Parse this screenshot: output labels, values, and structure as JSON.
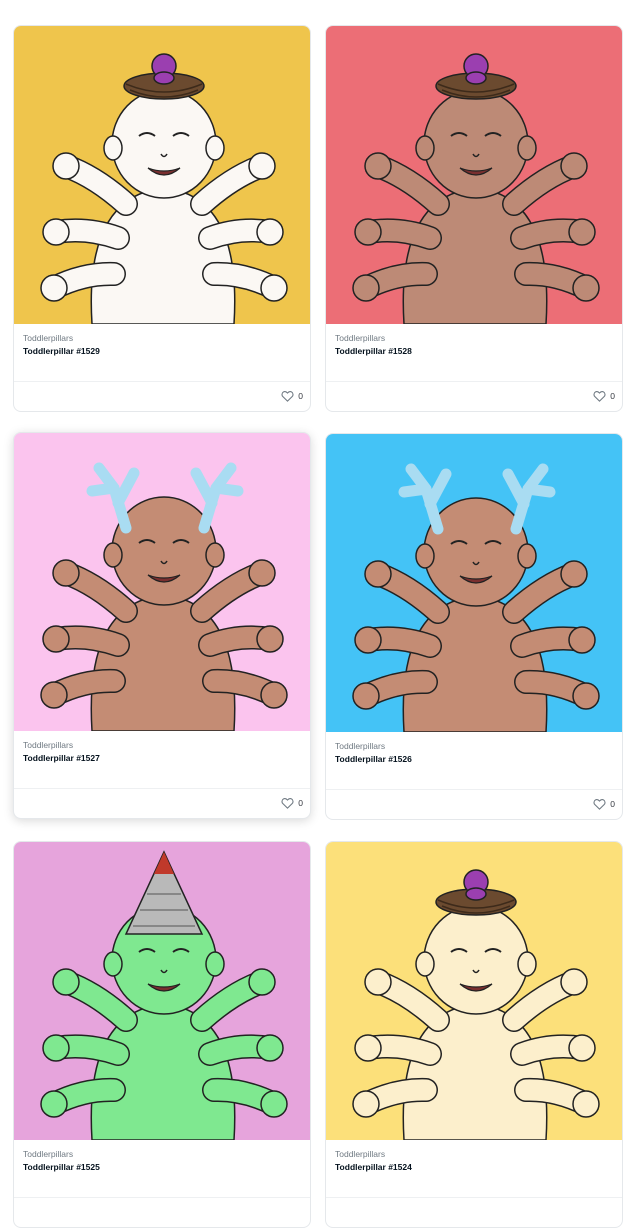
{
  "cards": [
    {
      "collection": "Toddlerpillars",
      "title": "Toddlerpillar #1529",
      "likes": "0",
      "bg": "#efc54c",
      "skin": "#fbf8f4",
      "top": "nest"
    },
    {
      "collection": "Toddlerpillars",
      "title": "Toddlerpillar #1528",
      "likes": "0",
      "bg": "#ec6e76",
      "skin": "#bd8a76",
      "top": "nest"
    },
    {
      "collection": "Toddlerpillars",
      "title": "Toddlerpillar #1527",
      "likes": "0",
      "bg": "#fbc4ee",
      "skin": "#c48c74",
      "top": "antlers"
    },
    {
      "collection": "Toddlerpillars",
      "title": "Toddlerpillar #1526",
      "likes": "0",
      "bg": "#44c3f6",
      "skin": "#c48c74",
      "top": "antlers"
    },
    {
      "collection": "Toddlerpillars",
      "title": "Toddlerpillar #1525",
      "likes": "",
      "bg": "#e6a4dc",
      "skin": "#7fe890",
      "top": "cone"
    },
    {
      "collection": "Toddlerpillars",
      "title": "Toddlerpillar #1524",
      "likes": "",
      "bg": "#fce07a",
      "skin": "#fcefcc",
      "top": "nest"
    }
  ]
}
